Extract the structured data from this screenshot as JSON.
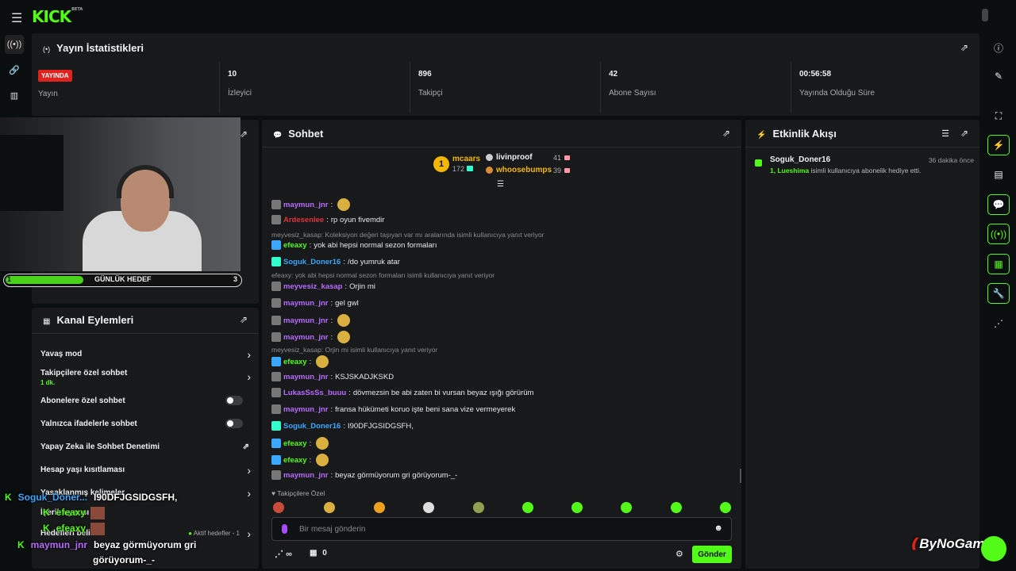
{
  "topbar": {
    "logo": "KICK",
    "logo_badge": "BETA"
  },
  "stats": {
    "title": "Yayın İstatistikleri",
    "live_badge": "YAYINDA",
    "stream_label": "Yayın",
    "cells": [
      {
        "value": "10",
        "label": "İzleyici"
      },
      {
        "value": "896",
        "label": "Takipçi"
      },
      {
        "value": "42",
        "label": "Abone Sayısı"
      },
      {
        "value": "00:56:58",
        "label": "Yayında Olduğu Süre"
      }
    ]
  },
  "chat": {
    "title": "Sohbet",
    "leaderboard": {
      "first": {
        "rank": "1",
        "name": "mcaars",
        "count": "172"
      },
      "second": {
        "name": "livinproof",
        "count": "41"
      },
      "third": {
        "name": "whoosebumps",
        "count": "39"
      }
    },
    "messages": [
      {
        "type": "msg",
        "user": "maymun_jnr",
        "color": "#b86bff",
        "text": ""
      },
      {
        "type": "msg",
        "user": "Ardesenlee",
        "color": "#e0343b",
        "text": "rp oyun fivemdir"
      },
      {
        "type": "reply",
        "text": "meyvesiz_kasap: Koleksiyon değeri taşıyan var mı aralarında isimli kullanıcıya yanıt veriyor"
      },
      {
        "type": "msg",
        "user": "efeaxy",
        "color": "#53fc18",
        "text": "yok abi hepsi normal sezon formaları"
      },
      {
        "type": "msg",
        "user": "Soguk_Doner16",
        "color": "#3aa8ff",
        "text": "/do yumruk atar"
      },
      {
        "type": "reply",
        "text": "efeaxy: yok abi hepsi normal sezon formaları isimli kullanıcıya yanıt veriyor"
      },
      {
        "type": "msg",
        "user": "meyvesiz_kasap",
        "color": "#b86bff",
        "text": "Orjin mi"
      },
      {
        "type": "msg",
        "user": "maymun_jnr",
        "color": "#b86bff",
        "text": "gel gwl"
      },
      {
        "type": "msg",
        "user": "maymun_jnr",
        "color": "#b86bff",
        "text": ""
      },
      {
        "type": "msg",
        "user": "maymun_jnr",
        "color": "#b86bff",
        "text": ""
      },
      {
        "type": "reply",
        "text": "meyvesiz_kasap: Orjin mi isimli kullanıcıya yanıt veriyor"
      },
      {
        "type": "msg",
        "user": "efeaxy",
        "color": "#53fc18",
        "text": ""
      },
      {
        "type": "msg",
        "user": "maymun_jnr",
        "color": "#b86bff",
        "text": "KSJSKADJKSKD"
      },
      {
        "type": "msg",
        "user": "LukasSsSs_buuu",
        "color": "#b86bff",
        "text": "dövmezsin be abi zaten bi vursan beyaz ışığı görürüm"
      },
      {
        "type": "msg",
        "user": "maymun_jnr",
        "color": "#b86bff",
        "text": "fransa hükümeti koruo işte beni sana vize vermeyerek"
      },
      {
        "type": "msg",
        "user": "Soguk_Doner16",
        "color": "#3aa8ff",
        "text": "I90DFJGSIDGSFH,"
      },
      {
        "type": "msg",
        "user": "efeaxy",
        "color": "#53fc18",
        "text": ""
      },
      {
        "type": "msg",
        "user": "efeaxy",
        "color": "#53fc18",
        "text": ""
      },
      {
        "type": "msg",
        "user": "maymun_jnr",
        "color": "#b86bff",
        "text": "beyaz görmüyorum gri görüyorum-_-"
      }
    ],
    "followers_only": "Takipçilere Özel",
    "input_placeholder": "Bir mesaj gönderin",
    "points": "∞",
    "gift_count": "0",
    "send_label": "Gönder"
  },
  "events": {
    "title": "Etkinlik Akışı",
    "items": [
      {
        "user": "Soguk_Doner16",
        "time": "36 dakika önce",
        "detail_user": "1, Lueshima",
        "detail_text": " isimli kullanıcıya abonelik hediye etti."
      }
    ]
  },
  "goal": {
    "start": "1",
    "label": "GÜNLÜK HEDEF",
    "target": "3"
  },
  "actions": {
    "title": "Kanal Eylemleri",
    "rows": [
      {
        "label": "Yavaş mod"
      },
      {
        "label": "Takipçilere özel sohbet",
        "sub": "1 dk."
      },
      {
        "label": "Abonelere özel sohbet"
      },
      {
        "label": "Yalnızca ifadelerle sohbet"
      },
      {
        "label": "Yapay Zeka ile Sohbet Denetimi"
      },
      {
        "label": "Hesap yaşı kısıtlaması"
      },
      {
        "label": "Yasaklanmış kelimeler"
      },
      {
        "label": "İçerik uyarısı"
      },
      {
        "label": "Hedefleri belirle"
      }
    ],
    "goal_status": "Aktif hedefler - 1"
  },
  "overlay": {
    "line1_user": "Soguk_Doner...",
    "line1_text": "I90DFJGSIDGSFH,",
    "line2_user": "efeaxy",
    "line3_user": "efeaxy",
    "line4_user": "maymun_jnr",
    "line4_text": "beyaz görmüyorum gri",
    "line4_text2": "görüyorum-_-"
  },
  "watermark": "ByNoGame"
}
